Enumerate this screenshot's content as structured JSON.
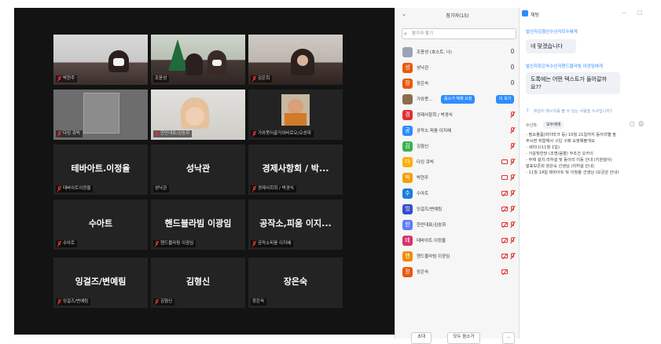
{
  "video_grid": {
    "tiles": [
      {
        "label": "박현주",
        "big": ""
      },
      {
        "label": "조윤성",
        "big": ""
      },
      {
        "label": "김은희",
        "big": ""
      },
      {
        "label": "다잉 큐빅",
        "big": ""
      },
      {
        "label": "한만대표/김송화",
        "big": ""
      },
      {
        "label": "가와못어끝가와바로오/오성대",
        "big": ""
      },
      {
        "label": "테바아트이정을",
        "big": "테바아트.이정율"
      },
      {
        "label": "성낙관",
        "big": "성낙관"
      },
      {
        "label": "경제사회회 / 박경식",
        "big": "경제사항회 / 박..."
      },
      {
        "label": "수아트",
        "big": "수아트"
      },
      {
        "label": "핸드블라핑 이광임",
        "big": "핸드블라빔 이광임"
      },
      {
        "label": "공작소피움 이지혜",
        "big": "공작소,피움 이지..."
      },
      {
        "label": "잉걸즈/변예림",
        "big": "잉걸즈/변예림"
      },
      {
        "label": "김형신",
        "big": "김형신"
      },
      {
        "label": "장은숙",
        "big": "장은숙"
      }
    ]
  },
  "participants": {
    "title": "참가자(15)",
    "search_placeholder": "참가자 찾기",
    "rows": [
      {
        "name": "조윤성 (호스트, 나)",
        "initial": "",
        "color": "#9aa3b5",
        "badge": ""
      },
      {
        "name": "성낙관",
        "initial": "성",
        "color": "#e8590c",
        "badge": ""
      },
      {
        "name": "장은숙",
        "initial": "장",
        "color": "#e8590c",
        "badge": ""
      },
      {
        "name": "가와못...",
        "initial": "",
        "color": "#8c6d4a",
        "badge": "음소거 해제 요청"
      },
      {
        "name": "경제사항회 / 박경식",
        "initial": "경",
        "color": "#e03131",
        "badge": ""
      },
      {
        "name": "공작소.피움 이지혜",
        "initial": "공",
        "color": "#2d8cff",
        "badge": ""
      },
      {
        "name": "김형신",
        "initial": "김",
        "color": "#37b24d",
        "badge": ""
      },
      {
        "name": "다잉 큐빅",
        "initial": "다",
        "color": "#fab005",
        "badge": ""
      },
      {
        "name": "박현주",
        "initial": "박",
        "color": "#f59f00",
        "badge": ""
      },
      {
        "name": "수아트",
        "initial": "수",
        "color": "#1c7ed6",
        "badge": ""
      },
      {
        "name": "잉걸즈/변예림",
        "initial": "잉",
        "color": "#364fc7",
        "badge": ""
      },
      {
        "name": "한만대표/김송화",
        "initial": "한",
        "color": "#5c7cfa",
        "badge": ""
      },
      {
        "name": "테바아트.이정율",
        "initial": "테",
        "color": "#d6336c",
        "badge": ""
      },
      {
        "name": "핸드블라빔 이광임",
        "initial": "핸",
        "color": "#f08c00",
        "badge": ""
      },
      {
        "name": "장은숙",
        "initial": "장",
        "color": "#e8590c",
        "badge": ""
      }
    ],
    "more_badge": "더 보기",
    "invite_label": "초대",
    "mute_all_label": "모두 음소거",
    "more_label": "..."
  },
  "chat": {
    "title": "채팅",
    "messages": [
      {
        "sender": "발신자김형신수신자모두에게",
        "text": "네 맞겠습니다"
      },
      {
        "sender": "발신자장은숙수신자핸드블라빔 이광임에게",
        "text": "도록에는 어떤 텍스트가 들어갈까요??"
      }
    ],
    "compose_hint": "파일이 메시지를 볼 수 있는 사람을 누구입니까?",
    "recipient_label": "수신자:",
    "recipient_value": "모두에게",
    "notice_lines": [
      "- 필요물품(마이마크 등) 10월 21일까지 동아리별 필",
      "  주시면 취합해서 구입 구매 요청해볼게요",
      "- 세미나(11월 1일)",
      "- 가윤빛한당 (조명/음향) 무조건 오카이",
      "- 무제 설치 리허설 및 동아리 이동 안내 (지원행사)",
      "  발표보존회 장은숙 선생님 (리허설 안내)",
      "- 11월 14일 테바아트 및 이정율 선생님 (보궁관 안내)"
    ]
  }
}
